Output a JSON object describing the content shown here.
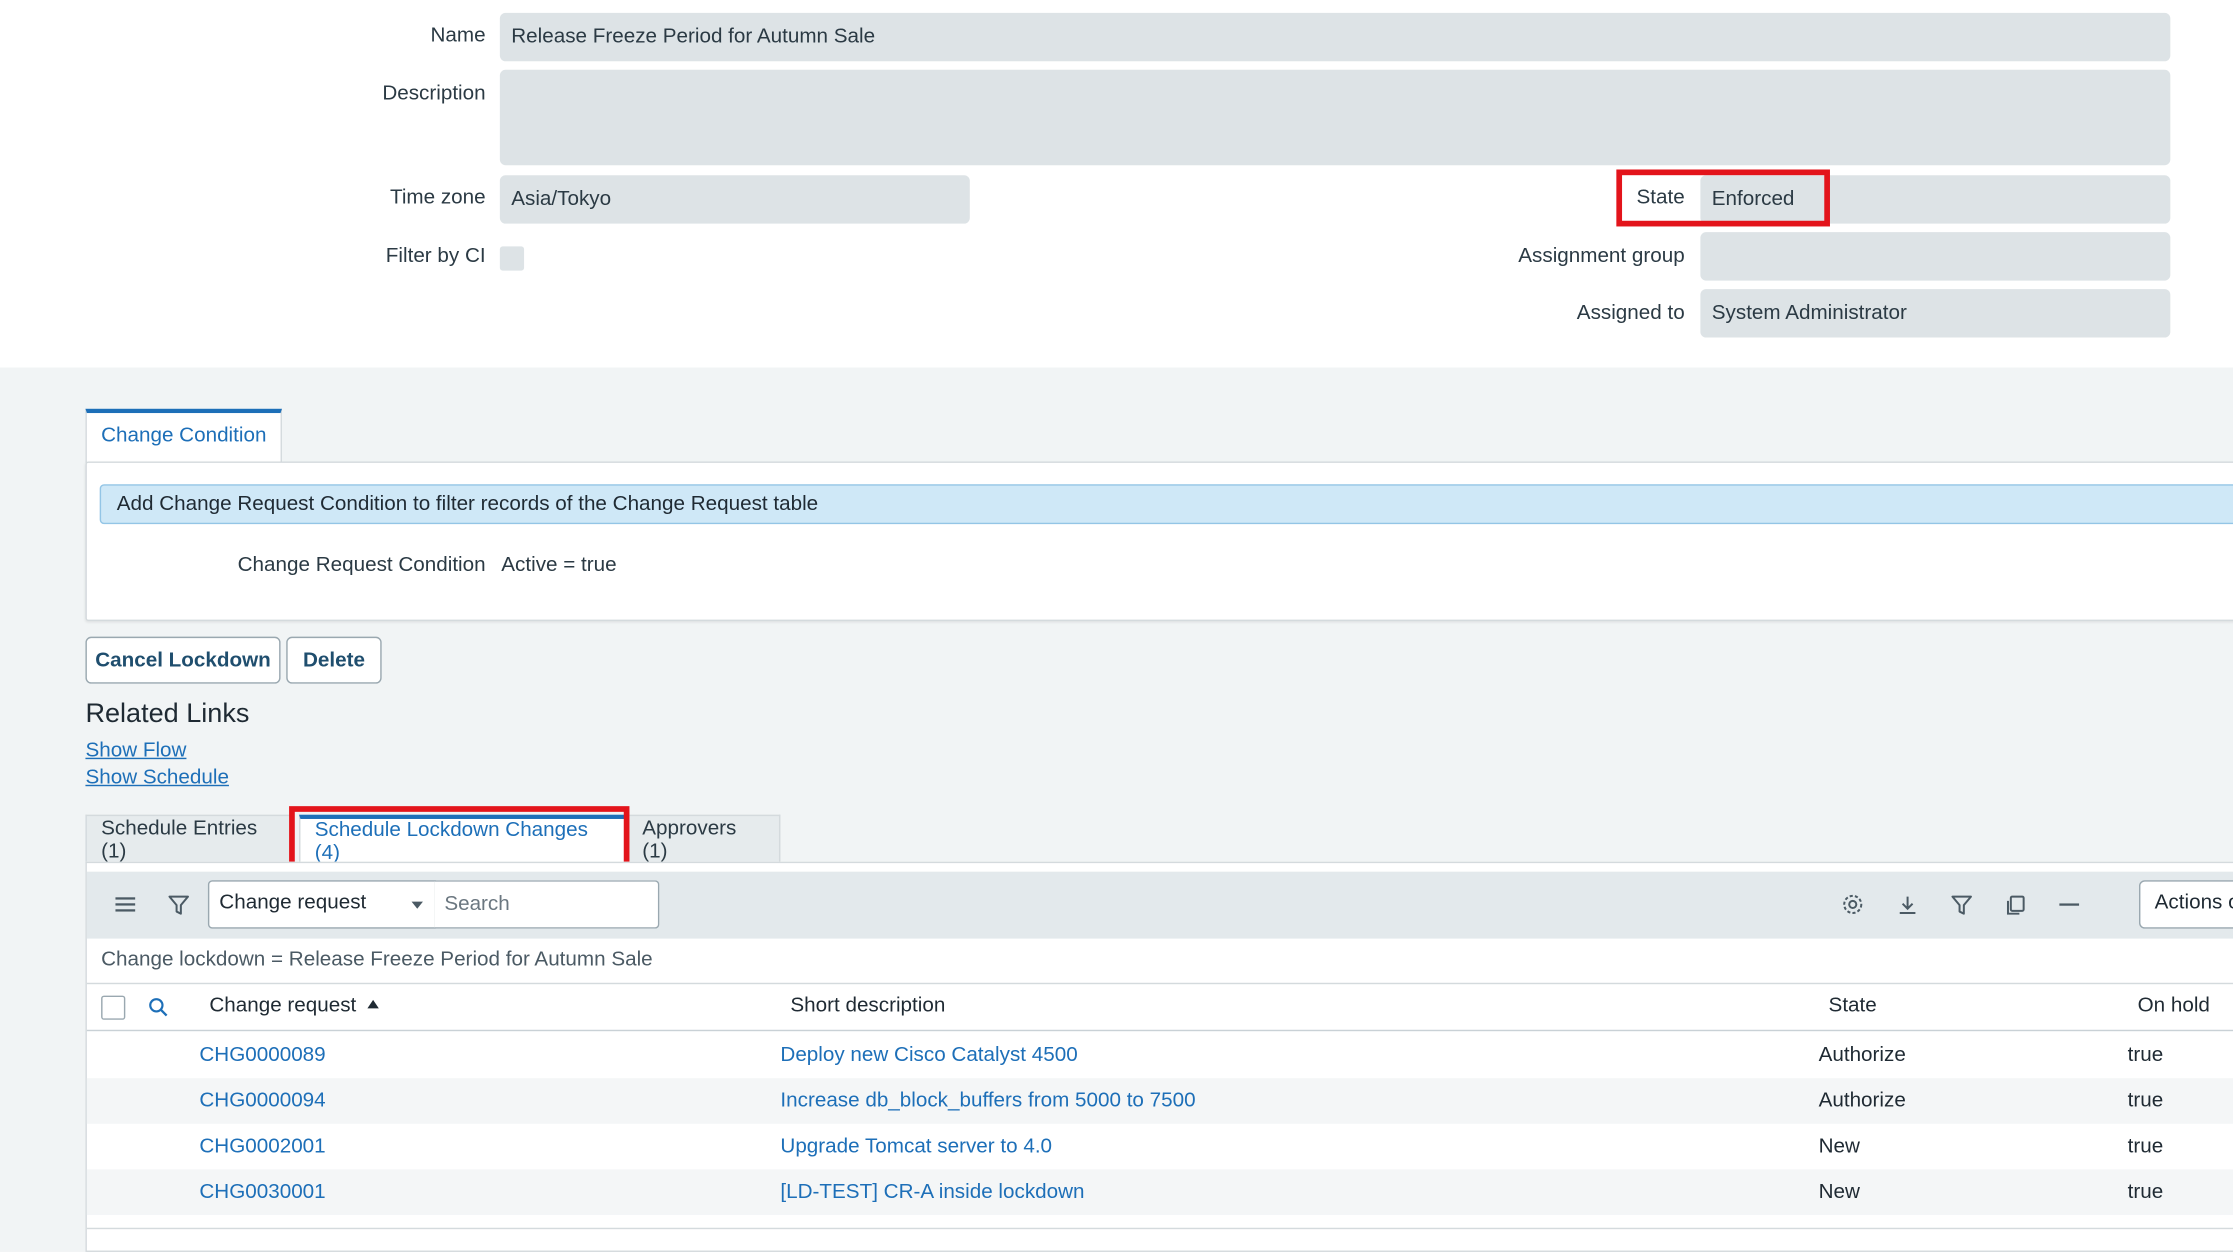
{
  "form": {
    "name_label": "Name",
    "name_value": "Release Freeze Period for Autumn Sale",
    "description_label": "Description",
    "description_value": "",
    "timezone_label": "Time zone",
    "timezone_value": "Asia/Tokyo",
    "filter_ci_label": "Filter by CI",
    "state_label": "State",
    "state_value": "Enforced",
    "assignment_group_label": "Assignment group",
    "assignment_group_value": "",
    "assigned_to_label": "Assigned to",
    "assigned_to_value": "System Administrator"
  },
  "condition": {
    "tab_label": "Change Condition",
    "info_text": "Add Change Request Condition to filter records of the Change Request table",
    "label": "Change Request Condition",
    "value": "Active = true"
  },
  "buttons": {
    "cancel_lockdown": "Cancel Lockdown",
    "delete": "Delete"
  },
  "related_links": {
    "title": "Related Links",
    "show_flow": "Show Flow",
    "show_schedule": "Show Schedule"
  },
  "related_tabs": [
    {
      "label": "Schedule Entries (1)"
    },
    {
      "label": "Schedule Lockdown Changes (4)"
    },
    {
      "label": "Approvers (1)"
    }
  ],
  "list": {
    "search_field": "Change request",
    "search_placeholder": "Search",
    "actions_label": "Actions o",
    "breadcrumb": "Change lockdown = Release Freeze Period for Autumn Sale",
    "columns": [
      "Change request",
      "Short description",
      "State",
      "On hold"
    ],
    "rows": [
      {
        "number": "CHG0000089",
        "short_description": "Deploy new Cisco Catalyst 4500",
        "state": "Authorize",
        "on_hold": "true"
      },
      {
        "number": "CHG0000094",
        "short_description": "Increase db_block_buffers from 5000 to 7500",
        "state": "Authorize",
        "on_hold": "true"
      },
      {
        "number": "CHG0002001",
        "short_description": "Upgrade Tomcat server to 4.0",
        "state": "New",
        "on_hold": "true"
      },
      {
        "number": "CHG0030001",
        "short_description": "[LD-TEST] CR-A inside lockdown",
        "state": "New",
        "on_hold": "true"
      }
    ]
  },
  "toolbar_icons": [
    "hamburger-icon",
    "filter-icon",
    "gear-icon",
    "download-icon",
    "filter-icon",
    "copy-icon",
    "minimize-icon"
  ],
  "colors": {
    "accent": "#1d6fb8",
    "highlight": "#e3141b",
    "field_bg": "#dde3e6",
    "info_bg": "#cfe8f7"
  }
}
